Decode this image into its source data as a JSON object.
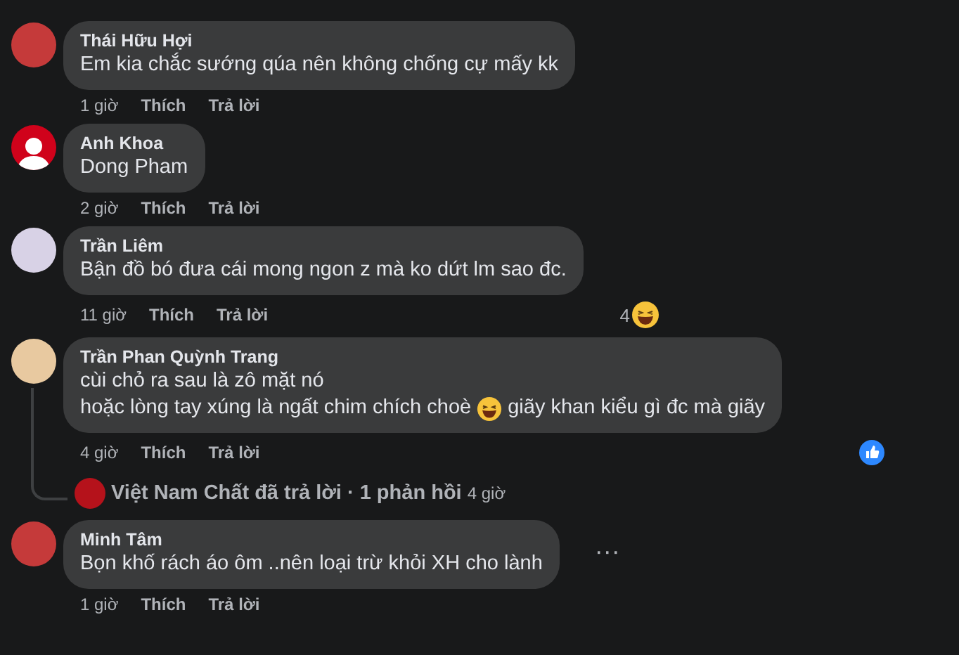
{
  "comments": [
    {
      "author": "Thái Hữu Hợi",
      "avatar": {
        "kind": "photo"
      },
      "lines": [
        [
          {
            "kind": "text",
            "text": "Em kia chắc sướng qúa nên không chống cự mấy kk"
          }
        ]
      ],
      "time": "1 giờ",
      "actions": [
        "Thích",
        "Trả lời"
      ]
    },
    {
      "author": "Anh Khoa",
      "avatar": {
        "kind": "default"
      },
      "lines": [
        [
          {
            "kind": "text",
            "text": "Dong Pham"
          }
        ]
      ],
      "time": "2 giờ",
      "actions": [
        "Thích",
        "Trả lời"
      ]
    },
    {
      "author": "Trần Liêm",
      "avatar": {
        "kind": "photo"
      },
      "lines": [
        [
          {
            "kind": "text",
            "text": "Bận đồ bó đưa cái mong ngon z mà ko dứt lm sao đc."
          }
        ]
      ],
      "time": "11 giờ",
      "actions": [
        "Thích",
        "Trả lời"
      ],
      "reaction": {
        "kind": "haha",
        "count": "4"
      }
    },
    {
      "author": "Trần Phan Quỳnh Trang",
      "avatar": {
        "kind": "photo"
      },
      "lines": [
        [
          {
            "kind": "text",
            "text": "cùi chỏ ra sau là zô mặt nó"
          }
        ],
        [
          {
            "kind": "text",
            "text": "hoặc lòng tay xúng là ngất chim chích choè"
          },
          {
            "kind": "emoji"
          },
          {
            "kind": "text",
            "text": "giãy khan kiểu gì đc mà giãy"
          }
        ]
      ],
      "time": "4 giờ",
      "actions": [
        "Thích",
        "Trả lời"
      ],
      "reaction": {
        "kind": "like"
      },
      "replies_summary": {
        "text": "Việt Nam Chất đã trả lời · 1 phản hồi",
        "time": "4 giờ"
      }
    },
    {
      "author": "Minh Tâm",
      "avatar": {
        "kind": "photo"
      },
      "lines": [
        [
          {
            "kind": "text",
            "text": "Bọn khố rách áo ôm ..nên loại trừ khỏi XH cho lành"
          }
        ]
      ],
      "time": "1 giờ",
      "actions": [
        "Thích",
        "Trả lời"
      ],
      "more_menu": {
        "label": "···"
      }
    }
  ]
}
